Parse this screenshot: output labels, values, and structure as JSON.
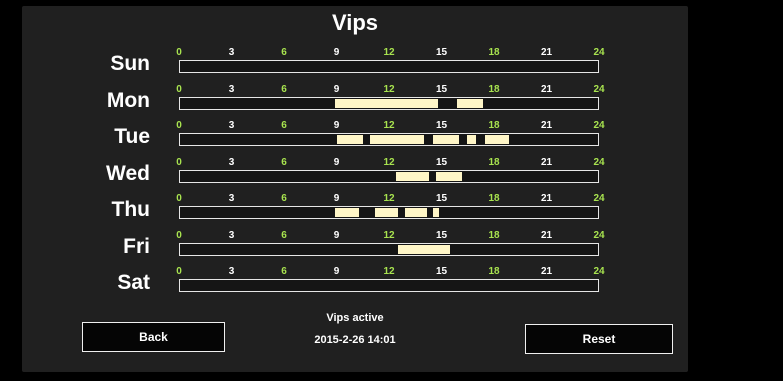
{
  "title": "Vips",
  "tick_labels": [
    "0",
    "3",
    "6",
    "9",
    "12",
    "15",
    "18",
    "21",
    "24"
  ],
  "colors": {
    "tick_green": "#a8e34f",
    "tick_white": "#ffffff",
    "active_segment": "#fff6c7"
  },
  "days": [
    {
      "label": "Sun",
      "segments": []
    },
    {
      "label": "Mon",
      "segments": [
        [
          8.9,
          14.8
        ],
        [
          15.9,
          17.4
        ]
      ]
    },
    {
      "label": "Tue",
      "segments": [
        [
          9.0,
          10.5
        ],
        [
          10.9,
          14.0
        ],
        [
          14.5,
          16.0
        ],
        [
          16.5,
          17.0
        ],
        [
          17.5,
          18.9
        ]
      ]
    },
    {
      "label": "Wed",
      "segments": [
        [
          12.4,
          14.3
        ],
        [
          14.7,
          16.2
        ]
      ]
    },
    {
      "label": "Thu",
      "segments": [
        [
          8.9,
          10.3
        ],
        [
          11.2,
          12.5
        ],
        [
          12.9,
          14.2
        ],
        [
          14.5,
          14.9
        ]
      ]
    },
    {
      "label": "Fri",
      "segments": [
        [
          12.5,
          15.5
        ]
      ]
    },
    {
      "label": "Sat",
      "segments": []
    }
  ],
  "status": "Vips active",
  "datetime": "2015-2-26 14:01",
  "buttons": {
    "back": "Back",
    "reset": "Reset"
  }
}
